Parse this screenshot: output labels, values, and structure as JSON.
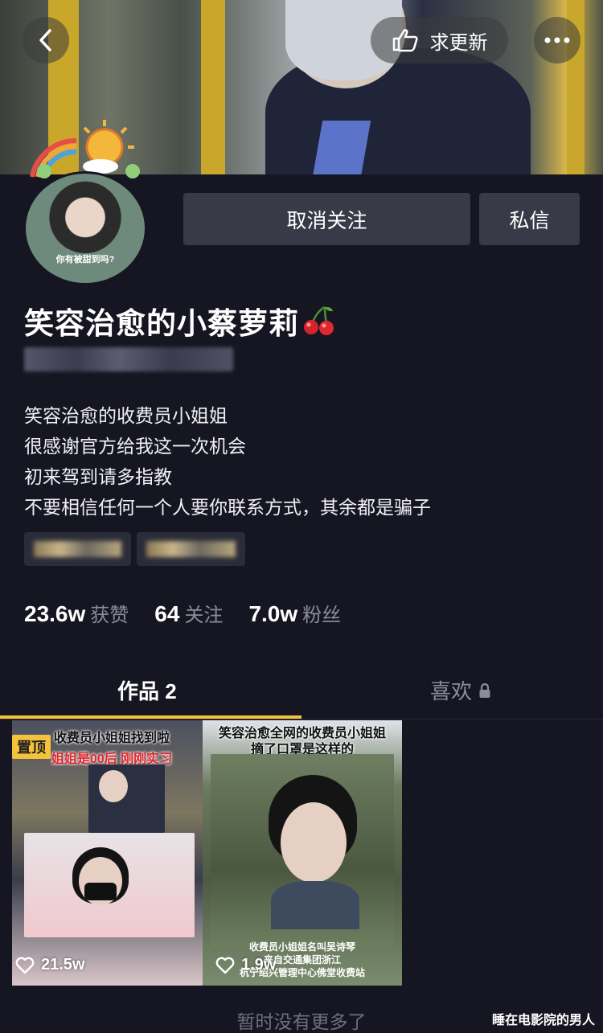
{
  "header": {
    "request_update_label": "求更新",
    "back_icon": "chevron-left-icon",
    "more_icon": "more-dots-icon",
    "hand_icon": "pointing-hand-icon"
  },
  "profile": {
    "avatar_caption": "你有被甜到吗?",
    "name": "笑容治愈的小蔡萝莉",
    "name_emoji": "cherry-icon"
  },
  "actions": {
    "unfollow_label": "取消关注",
    "message_label": "私信"
  },
  "bio": [
    "笑容治愈的收费员小姐姐",
    "很感谢官方给我这一次机会",
    "初来驾到请多指教",
    "不要相信任何一个人要你联系方式，其余都是骗子"
  ],
  "stats": {
    "likes_value": "23.6w",
    "likes_label": "获赞",
    "following_value": "64",
    "following_label": "关注",
    "followers_value": "7.0w",
    "followers_label": "粉丝"
  },
  "tabs": {
    "works_label": "作品 2",
    "likes_label": "喜欢"
  },
  "videos": [
    {
      "pinned_label": "置顶",
      "title_line1": "收费员小姐姐找到啦",
      "title_line2": "姐姐是00后 刚刚实习",
      "likes": "21.5w"
    },
    {
      "title_line1": "笑容治愈全网的收费员小姐姐",
      "title_line2": "摘了口罩是这样的",
      "caption_line1": "收费员小姐姐名叫吴诗琴",
      "caption_line2": "来自交通集团浙江",
      "caption_line3": "杭宁绍兴管理中心佛堂收费站",
      "likes": "1.9w"
    }
  ],
  "footer": {
    "no_more_label": "暂时没有更多了",
    "watermark": "睡在电影院的男人"
  },
  "colors": {
    "background": "#161623",
    "button": "#393a47",
    "accent": "#f5c33b",
    "muted_text": "#8c8d99"
  }
}
